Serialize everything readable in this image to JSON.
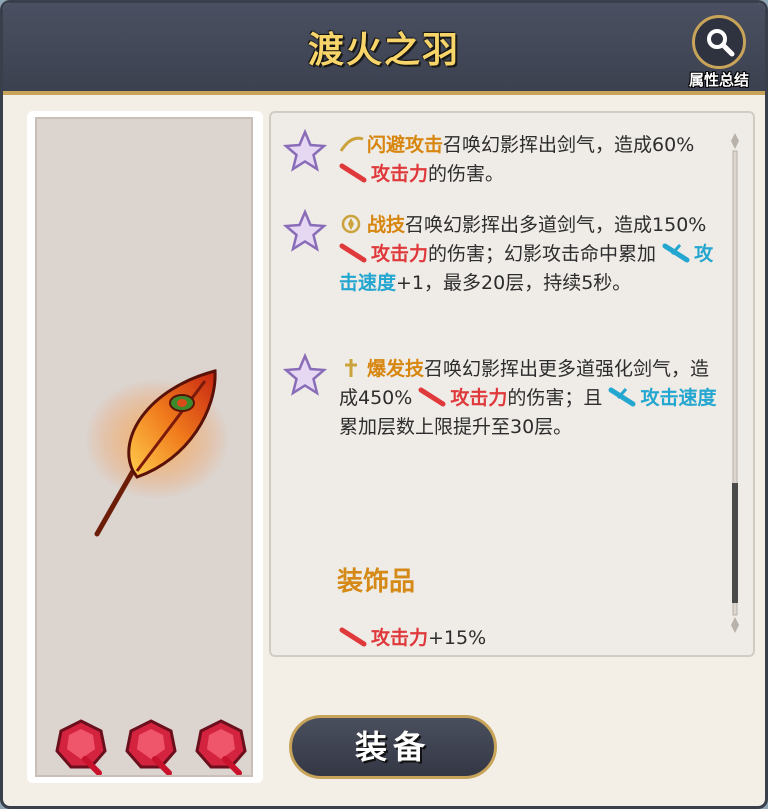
{
  "header": {
    "title": "渡火之羽",
    "summary_label": "属性总结"
  },
  "entries": [
    {
      "icon": "dodge-attack-icon",
      "name": "闪避攻击",
      "t1": "召唤幻影挥出剑气，造成60%",
      "atk": "攻击力",
      "t2": "的伤害。"
    },
    {
      "icon": "battle-skill-icon",
      "name": "战技",
      "t1": "召唤幻影挥出多道剑气，造成150%",
      "atk": "攻击力",
      "t2": "的伤害；幻影攻击命中累加",
      "spd": "攻击速度",
      "t3": "+1，最多20层，持续5秒。"
    },
    {
      "icon": "burst-skill-icon",
      "name": "爆发技",
      "t1": "召唤幻影挥出更多道强化剑气，造成450%",
      "atk": "攻击力",
      "t2": "的伤害；且",
      "spd": "攻击速度",
      "t3": "累加层数上限提升至30层。"
    }
  ],
  "decoration": {
    "title": "装饰品",
    "stat": "攻击力",
    "value": "+15%"
  },
  "equip_button": "装备",
  "colors": {
    "accent_gold": "#c8a45a",
    "title_yellow": "#f7d56a",
    "skill_orange": "#d7860f",
    "attack_red": "#e0393b",
    "speed_cyan": "#23a6cf"
  }
}
